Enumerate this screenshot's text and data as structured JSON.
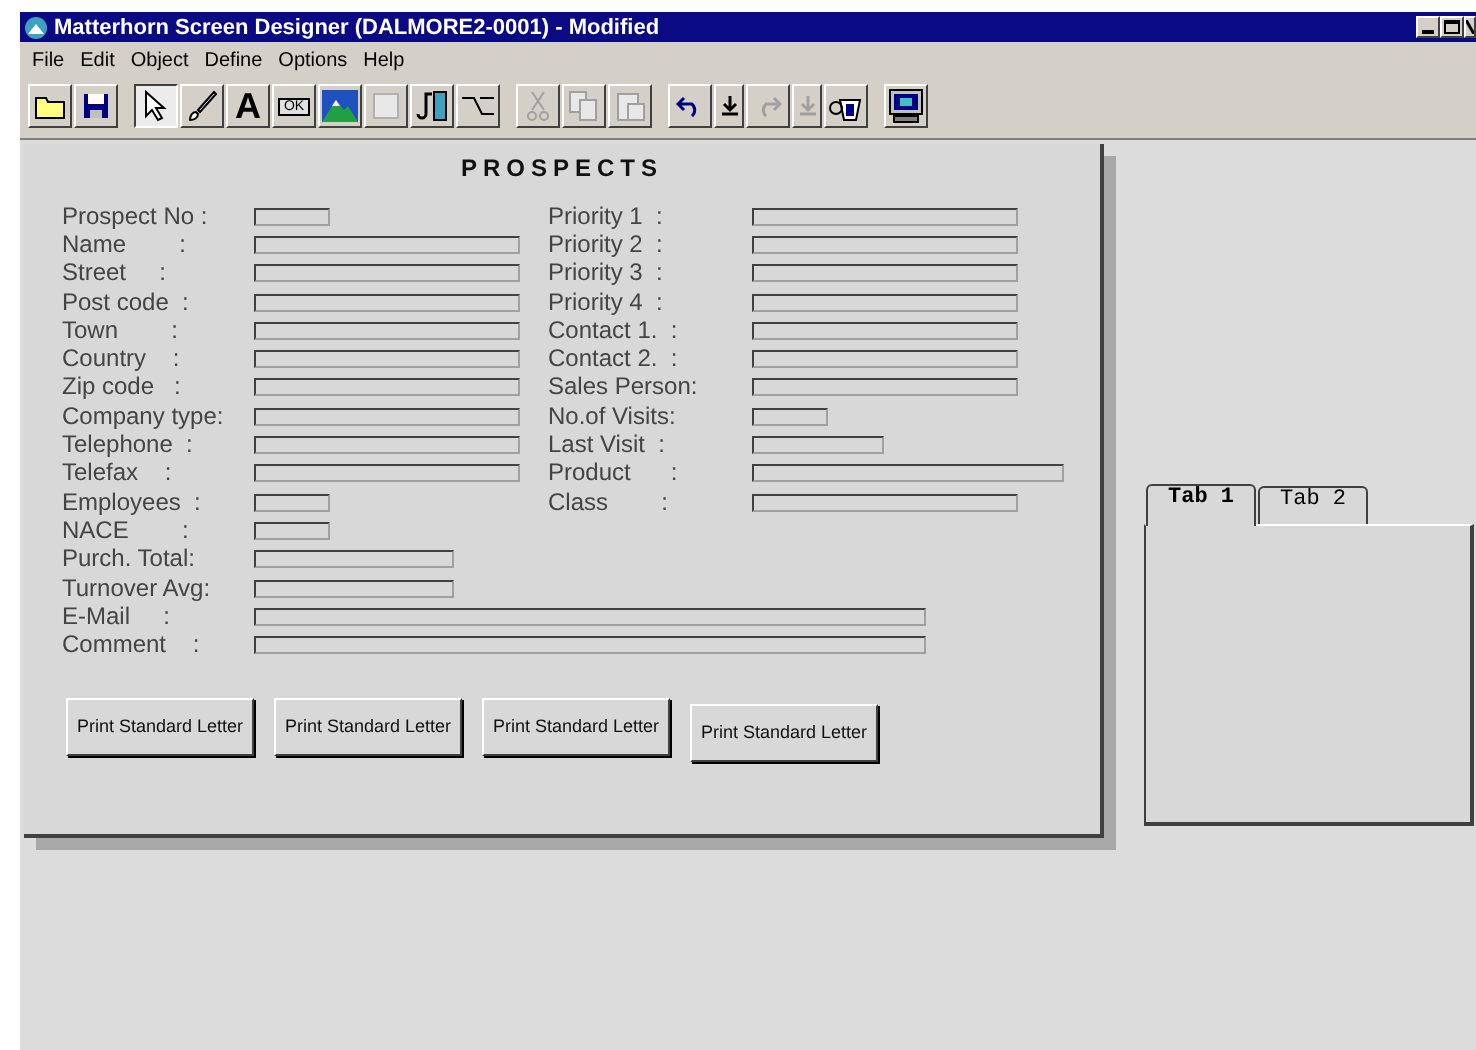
{
  "window": {
    "title": "Matterhorn Screen Designer (DALMORE2-0001) - Modified"
  },
  "menu": [
    "File",
    "Edit",
    "Object",
    "Define",
    "Options",
    "Help"
  ],
  "toolbar": [
    [
      {
        "kind": "open"
      },
      {
        "kind": "save"
      }
    ],
    [
      {
        "kind": "pointer",
        "selected": true
      },
      {
        "kind": "brush",
        "selected": false
      },
      {
        "kind": "text",
        "label": "A",
        "selected": false
      },
      {
        "kind": "okbutton",
        "label": "OK",
        "selected": false
      },
      {
        "kind": "image",
        "selected": false
      },
      {
        "kind": "blank",
        "selected": false
      },
      {
        "kind": "media",
        "selected": false
      },
      {
        "kind": "connector",
        "selected": false
      }
    ],
    [
      {
        "kind": "cut",
        "disabled": true
      },
      {
        "kind": "copy",
        "disabled": true
      },
      {
        "kind": "paste",
        "disabled": true
      }
    ],
    [
      {
        "kind": "undo",
        "disabled": false
      },
      {
        "kind": "drop",
        "disabled": false
      },
      {
        "kind": "redo",
        "disabled": true
      },
      {
        "kind": "drop",
        "disabled": true
      },
      {
        "kind": "bucket",
        "disabled": false
      }
    ],
    [
      {
        "kind": "monitor"
      }
    ]
  ],
  "form": {
    "title": "PROSPECTS",
    "left": [
      {
        "label": "Prospect No :",
        "kind": "small"
      },
      {
        "label": "Name        :",
        "kind": "long"
      },
      {
        "label": "Street     :",
        "kind": "long"
      },
      {
        "label": "Post code  :",
        "kind": "long"
      },
      {
        "label": "Town        :",
        "kind": "long"
      },
      {
        "label": "Country    :",
        "kind": "long"
      },
      {
        "label": "Zip code   :",
        "kind": "long"
      },
      {
        "label": "Company type:",
        "kind": "long"
      },
      {
        "label": "Telephone  :",
        "kind": "long"
      },
      {
        "label": "Telefax    :",
        "kind": "long"
      },
      {
        "label": "Employees  :",
        "kind": "small"
      },
      {
        "label": "NACE        :",
        "kind": "small"
      },
      {
        "label": "Purch. Total:",
        "kind": "medium"
      },
      {
        "label": "Turnover Avg:",
        "kind": "medium"
      },
      {
        "label": "E-Mail     :",
        "kind": "full"
      },
      {
        "label": "Comment    :",
        "kind": "full"
      }
    ],
    "right": [
      {
        "label": "Priority 1  :",
        "kind": "long"
      },
      {
        "label": "Priority 2  :",
        "kind": "long"
      },
      {
        "label": "Priority 3  :",
        "kind": "long"
      },
      {
        "label": "Priority 4  :",
        "kind": "long"
      },
      {
        "label": "Contact 1.  :",
        "kind": "long"
      },
      {
        "label": "Contact 2.  :",
        "kind": "long"
      },
      {
        "label": "Sales Person:",
        "kind": "long"
      },
      {
        "label": "No.of Visits:",
        "kind": "small"
      },
      {
        "label": "Last Visit  :",
        "kind": "mid"
      },
      {
        "label": "Product      :",
        "kind": "wide"
      },
      {
        "label": "Class        :",
        "kind": "long"
      }
    ],
    "buttons": [
      {
        "label": "Print Standard Letter"
      },
      {
        "label": "Print Standard Letter"
      },
      {
        "label": "Print Standard Letter"
      },
      {
        "label": "Print Standard Letter"
      }
    ]
  },
  "tabs": [
    {
      "label": "Tab 1",
      "selected": true
    },
    {
      "label": "Tab 2",
      "selected": false
    }
  ]
}
